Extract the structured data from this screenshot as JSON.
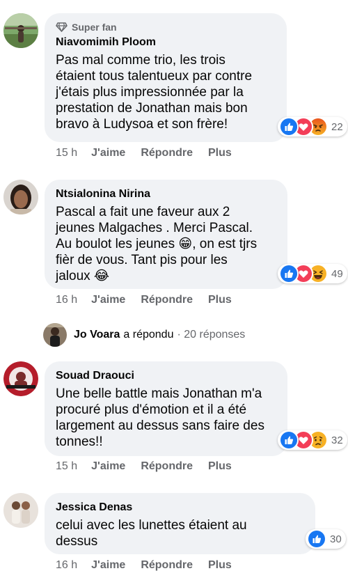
{
  "comments": [
    {
      "badge": "Super fan",
      "author": "Niavomimih Ploom",
      "text": "Pas mal comme trio, les trois\nétaient tous talentueux par contre\nj'étais plus impressionnée par la\nprestation de Jonathan mais bon\nbravo à Ludysoa et son frère!",
      "reactions": [
        "like",
        "love",
        "angry"
      ],
      "reaction_count": "22",
      "time": "15 h",
      "like_label": "J'aime",
      "reply_label": "Répondre",
      "more_label": "Plus"
    },
    {
      "author": "Ntsialonina Nirina",
      "text": "Pascal a fait une faveur aux 2\njeunes Malgaches . Merci Pascal.\nAu boulot les jeunes 😁, on est tjrs\nfièr de vous. Tant pis pour les\njaloux 😂",
      "reactions": [
        "like",
        "love",
        "haha"
      ],
      "reaction_count": "49",
      "time": "16 h",
      "like_label": "J'aime",
      "reply_label": "Répondre",
      "more_label": "Plus",
      "reply_summary": {
        "name": "Jo Voara",
        "verb": "a répondu",
        "count": "· 20 réponses"
      }
    },
    {
      "author": "Souad Draouci",
      "text": "Une belle battle mais Jonathan m'a\nprocuré plus d'émotion et il a été\nlargement au dessus sans faire des\ntonnes!!",
      "reactions": [
        "like",
        "love",
        "sad"
      ],
      "reaction_count": "32",
      "time": "15 h",
      "like_label": "J'aime",
      "reply_label": "Répondre",
      "more_label": "Plus"
    },
    {
      "author": "Jessica Denas",
      "text": "celui avec les lunettes étaient au\ndessus",
      "reactions": [
        "like"
      ],
      "reaction_count": "30",
      "time": "16 h",
      "like_label": "J'aime",
      "reply_label": "Répondre",
      "more_label": "Plus"
    }
  ],
  "colors": {
    "bubble": "#f0f2f5",
    "secondary_text": "#65676b",
    "like_blue": "#1877f2",
    "love_red": "#f33e58",
    "emoji_yellow": "#f7b125"
  }
}
